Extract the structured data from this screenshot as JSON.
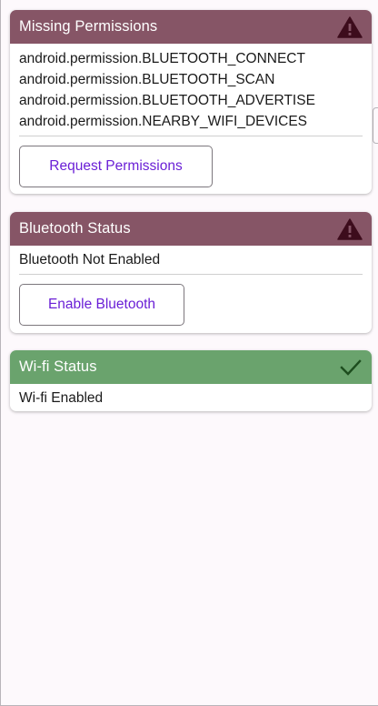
{
  "colors": {
    "warning_header": "#865566",
    "ok_header": "#6aa36d",
    "button_text": "#6a1fd6",
    "warning_icon": "#3d0c1c",
    "check_icon": "#1d4d1e"
  },
  "permissions_card": {
    "title": "Missing Permissions",
    "status_icon": "warning-icon",
    "permissions": [
      "android.permission.BLUETOOTH_CONNECT",
      "android.permission.BLUETOOTH_SCAN",
      "android.permission.BLUETOOTH_ADVERTISE",
      "android.permission.NEARBY_WIFI_DEVICES"
    ],
    "button_label": "Request Permissions"
  },
  "bluetooth_card": {
    "title": "Bluetooth Status",
    "status_icon": "warning-icon",
    "status_text": "Bluetooth Not Enabled",
    "button_label": "Enable Bluetooth"
  },
  "wifi_card": {
    "title": "Wi-fi Status",
    "status_icon": "check-icon",
    "status_text": "Wi-fi Enabled"
  }
}
